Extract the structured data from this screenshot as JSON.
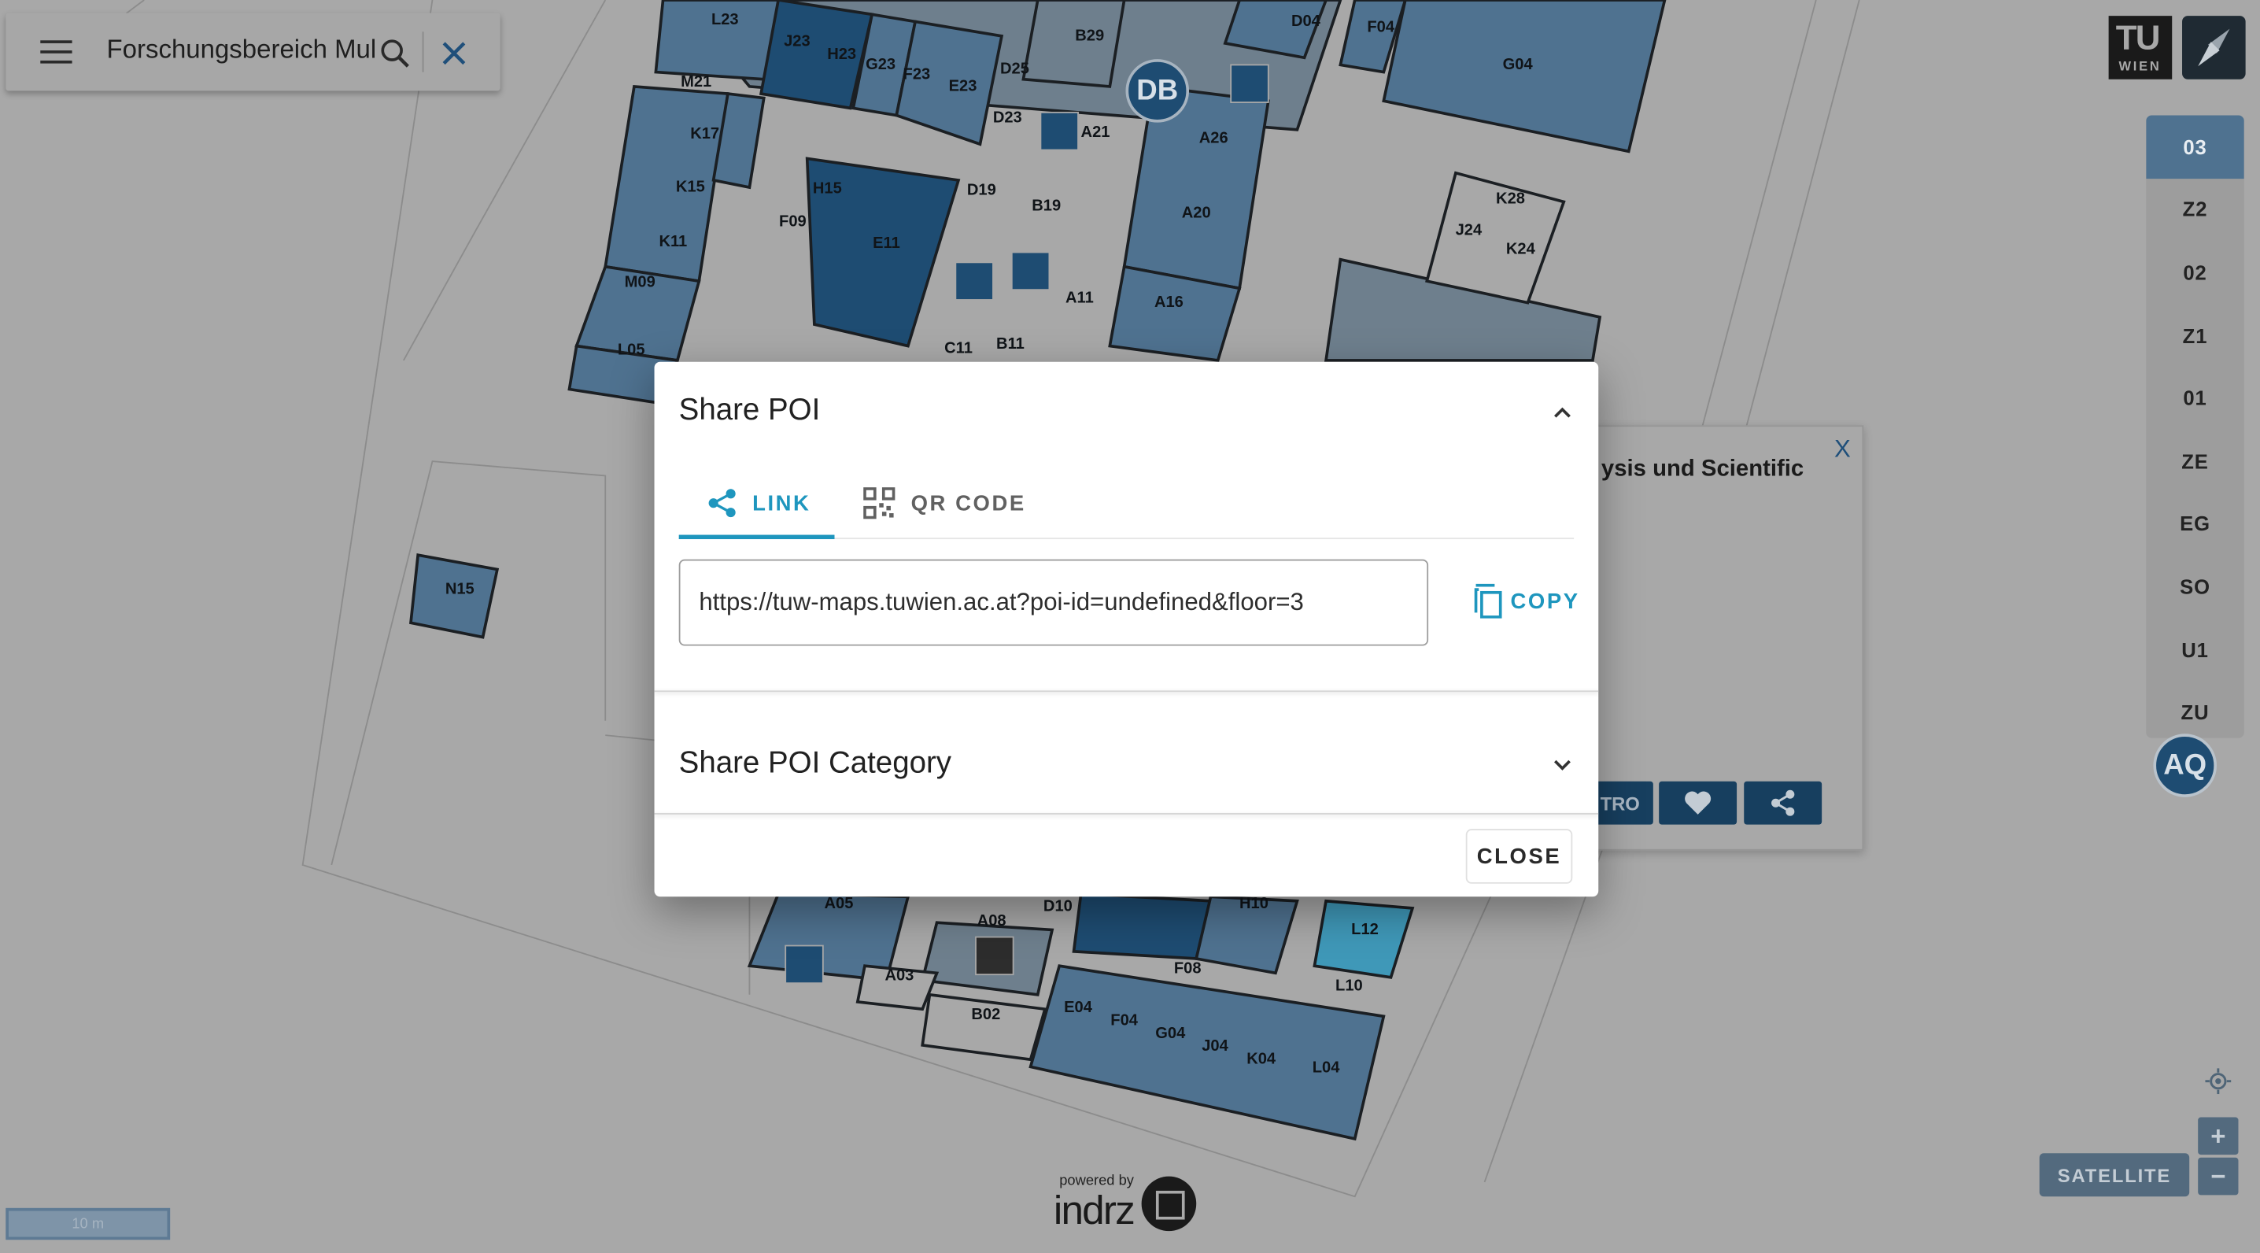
{
  "search": {
    "value": "Forschungsbereich Mul"
  },
  "map": {
    "rooms": [
      "L23",
      "J23",
      "H23",
      "G23",
      "F23",
      "E23",
      "D25",
      "B29",
      "D04",
      "F04",
      "G04",
      "M21",
      "K17",
      "K15",
      "K11",
      "M09",
      "L05",
      "H15",
      "F09",
      "E11",
      "D23",
      "A21",
      "D19",
      "B19",
      "A26",
      "A20",
      "A16",
      "A11",
      "C11",
      "B11",
      "J24",
      "K28",
      "K24",
      "N15",
      "A05",
      "A08",
      "D10",
      "H10",
      "L12",
      "A03",
      "B02",
      "F08",
      "L10",
      "E04",
      "F04",
      "G04",
      "J04",
      "K04",
      "L04"
    ],
    "badges": {
      "db": "DB",
      "aq": "AQ"
    }
  },
  "info_card": {
    "title": "ysis und Scientific",
    "close": "X",
    "route_label": "TRO"
  },
  "floors": [
    "03",
    "Z2",
    "02",
    "Z1",
    "01",
    "ZE",
    "EG",
    "SO",
    "U1",
    "ZU"
  ],
  "active_floor": "03",
  "controls": {
    "satellite": "SATELLITE",
    "zoom_in": "+",
    "zoom_out": "−",
    "scale": "10 m"
  },
  "logo": {
    "tu_top": "TU",
    "tu_bottom": "WIEN",
    "powered_by": "powered by",
    "brand": "indrz"
  },
  "dialog": {
    "title": "Share POI",
    "tabs": [
      {
        "label": "LINK",
        "active": true
      },
      {
        "label": "QR CODE",
        "active": false
      }
    ],
    "url": "https://tuw-maps.tuwien.ac.at?poi-id=undefined&floor=3",
    "copy_label": "COPY",
    "category_title": "Share POI Category",
    "close_label": "CLOSE"
  },
  "colors": {
    "accent": "#1e96be",
    "room_dark": "#173f5f",
    "room_mid": "#4f7290",
    "overlay_bg": "#a8a8a8"
  }
}
